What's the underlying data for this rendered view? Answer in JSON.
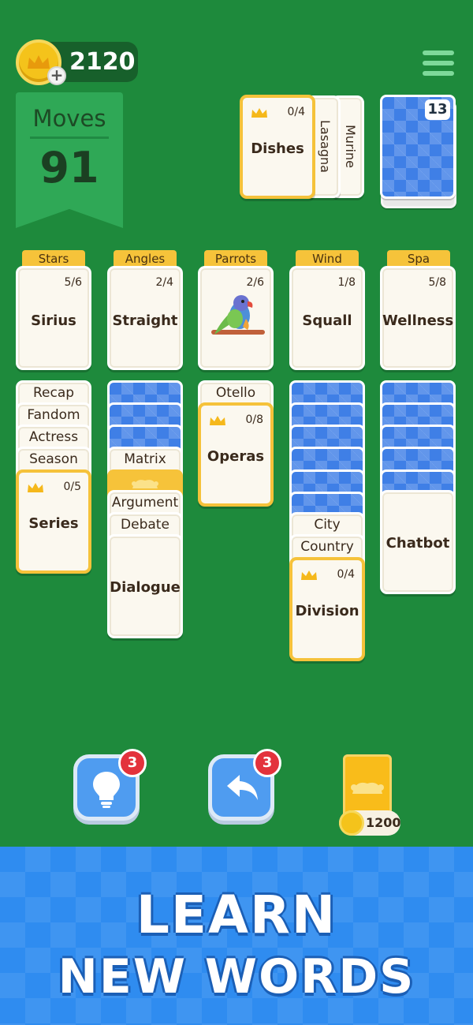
{
  "coins": {
    "value": "2120"
  },
  "moves": {
    "label": "Moves",
    "value": "91"
  },
  "stock": {
    "active": {
      "word": "Dishes",
      "count": "0/4"
    },
    "side_words": [
      "Lasagna",
      "Murine"
    ],
    "deck_count": "13"
  },
  "categories": [
    {
      "tab": "Stars",
      "word": "Sirius",
      "count": "5/6"
    },
    {
      "tab": "Angles",
      "word": "Straight",
      "count": "2/4"
    },
    {
      "tab": "Parrots",
      "word": "",
      "count": "2/6",
      "image": "parrot-illustration"
    },
    {
      "tab": "Wind",
      "word": "Squall",
      "count": "1/8"
    },
    {
      "tab": "Spa",
      "word": "Wellness",
      "count": "5/8"
    }
  ],
  "columns": {
    "col1": {
      "stack": [
        "Recap",
        "Fandom",
        "Actress",
        "Season"
      ],
      "top": {
        "word": "Series",
        "count": "0/5"
      }
    },
    "col2": {
      "stack": [
        "Matrix",
        "Argument",
        "Debate"
      ],
      "top": {
        "word": "Dialogue"
      }
    },
    "col3": {
      "stack": [
        "Otello"
      ],
      "top": {
        "word": "Operas",
        "count": "0/8"
      }
    },
    "col4": {
      "stack": [
        "City",
        "Country"
      ],
      "top": {
        "word": "Division",
        "count": "0/4"
      }
    },
    "col5": {
      "top": {
        "word": "Chatbot"
      }
    }
  },
  "controls": {
    "hint_badge": "3",
    "undo_badge": "3",
    "joker_price": "1200",
    "hint_icon": "lightbulb-icon",
    "undo_icon": "undo-arrow-icon"
  },
  "banner": {
    "line1": "LEARN",
    "line2": "NEW WORDS"
  },
  "colors": {
    "felt": "#1e8a3c",
    "gold": "#f5c23a",
    "card_back": "#3f7fe6",
    "button_blue": "#4f9cf0",
    "badge_red": "#e3323c"
  }
}
